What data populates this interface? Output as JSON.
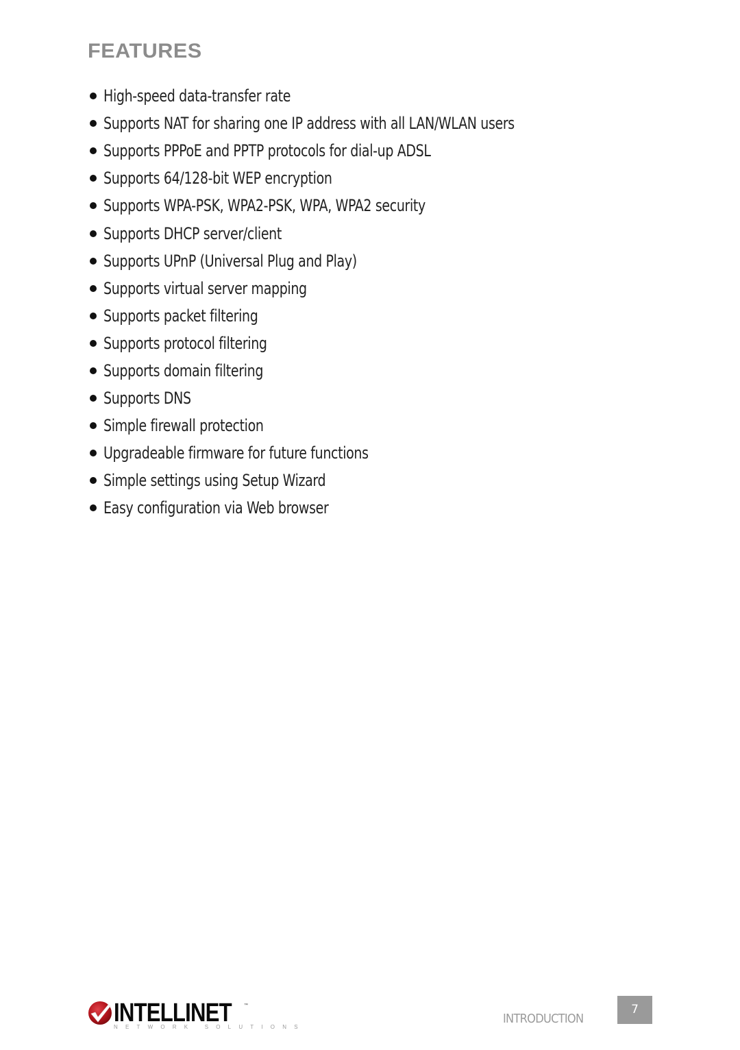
{
  "page": {
    "title": "FEATURES",
    "features": [
      "High-speed data-transfer rate",
      "Supports NAT for sharing one IP address with all LAN/WLAN users",
      "Supports PPPoE and PPTP protocols for dial-up ADSL",
      "Supports 64/128-bit WEP encryption",
      "Supports WPA-PSK, WPA2-PSK, WPA, WPA2 security",
      "Supports DHCP server/client",
      "Supports UPnP (Universal Plug and Play)",
      "Supports virtual server mapping",
      "Supports packet filtering",
      "Supports protocol filtering",
      "Supports domain filtering",
      "Supports DNS",
      "Simple firewall protection",
      "Upgradeable firmware for future functions",
      "Simple settings using Setup Wizard",
      "Easy configuration via Web browser"
    ]
  },
  "footer": {
    "logo": {
      "wordmark": "INTELLINET",
      "trademark": "™",
      "tagline": "NETWORK SOLUTIONS",
      "icon": "checkmark-badge-icon",
      "brand_color": "#b3141c"
    },
    "section_label": "INTRODUCTION",
    "page_number": "7"
  },
  "colors": {
    "title": "#8c8c8c",
    "body_text": "#222222",
    "footer_label": "#9b9b9b",
    "page_box": "#9a9a9a"
  }
}
